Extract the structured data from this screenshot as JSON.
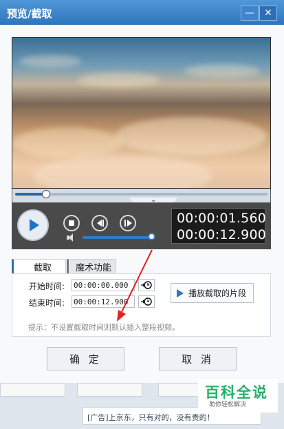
{
  "window": {
    "title": "预览/截取",
    "minimize_symbol": "—",
    "close_symbol": "✕"
  },
  "player": {
    "progress_fraction": 0.12,
    "volume_fraction": 0.98,
    "current_time": "00:00:01.560",
    "total_time": "00:00:12.900"
  },
  "tabs": [
    {
      "label": "截取",
      "active": true
    },
    {
      "label": "魔术功能",
      "active": false
    }
  ],
  "form": {
    "start_label": "开始时间:",
    "start_value": "00:00:00.000",
    "end_label": "结束时间:",
    "end_value": "00:00:12.900",
    "play_clip_label": "播放截取的片段",
    "tip": "提示：不设置截取时间则默认插入整段视频。"
  },
  "buttons": {
    "ok": "确 定",
    "cancel": "取 消"
  },
  "bottom": {
    "ad_text": "[广告]上京东，只有对的，没有贵的！",
    "watermark_title": "百科全说",
    "watermark_sub": "助你轻松解决"
  },
  "colors": {
    "title_bar": "#3f86cc",
    "accent": "#2a74c3",
    "watermark_green": "#25b06b",
    "arrow_red": "#e02222"
  },
  "icons": [
    "minimize-icon",
    "close-icon",
    "play-icon",
    "stop-icon",
    "previous-frame-icon",
    "next-frame-icon",
    "volume-icon",
    "reset-time-icon",
    "play-clip-icon"
  ]
}
